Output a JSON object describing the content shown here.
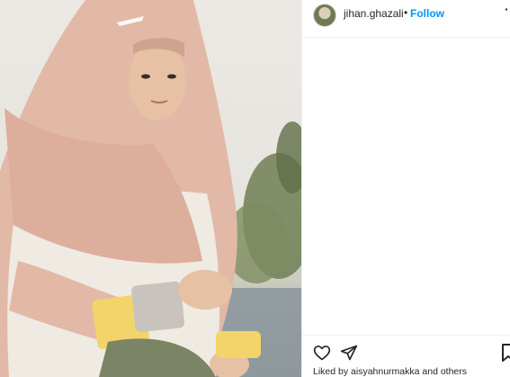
{
  "header": {
    "username": "jihan.ghazali",
    "separator": "•",
    "follow_label": "Follow",
    "more_label": "·"
  },
  "actions": {
    "like_icon": "heart-outline-icon",
    "share_icon": "paper-plane-icon",
    "save_icon": "bookmark-icon"
  },
  "likes": {
    "text": "Liked by aisyahnurmakka and others"
  },
  "colors": {
    "follow": "#0095f6",
    "text": "#262626",
    "border": "#efefef"
  }
}
